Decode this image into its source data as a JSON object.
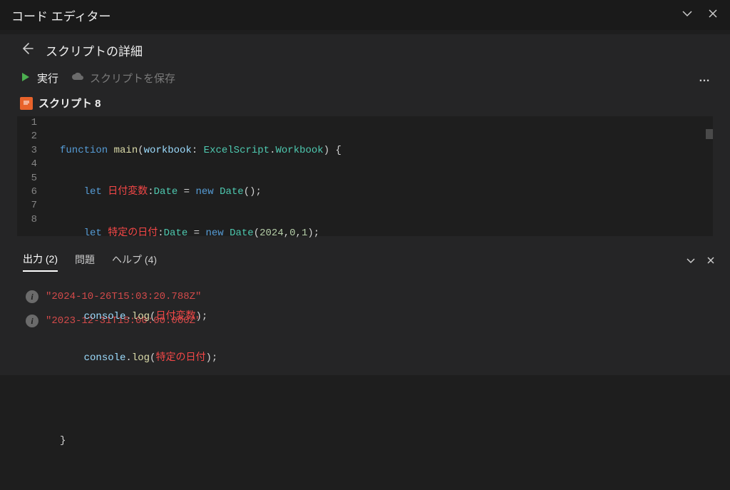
{
  "titlebar": {
    "title": "コード エディター"
  },
  "panel": {
    "header_title": "スクリプトの詳細",
    "run_label": "実行",
    "save_label": "スクリプトを保存",
    "more_label": "…",
    "script_name": "スクリプト 8"
  },
  "editor": {
    "line_numbers": [
      "1",
      "2",
      "3",
      "4",
      "5",
      "6",
      "7",
      "8"
    ],
    "code": {
      "l1": {
        "kw1": "function",
        "fn": "main",
        "p1": "(",
        "param": "workbook",
        "colon": ":",
        "ns": "ExcelScript",
        "dot": ".",
        "cls": "Workbook",
        "p2": ")",
        "sp": " ",
        "brace": "{"
      },
      "l2": {
        "kw": "let",
        "var": "日付変数",
        "colon": ":",
        "type": "Date",
        "eq": " = ",
        "new": "new",
        "sp": " ",
        "ctor": "Date",
        "args": "();"
      },
      "l3": {
        "kw": "let",
        "var": "特定の日付",
        "colon": ":",
        "type": "Date",
        "eq": " = ",
        "new": "new",
        "sp": " ",
        "ctor": "Date",
        "po": "(",
        "n1": "2024",
        "c1": ",",
        "n2": "0",
        "c2": ",",
        "n3": "1",
        "pc": ");"
      },
      "l5": {
        "obj": "console",
        "dot": ".",
        "fn": "log",
        "po": "(",
        "arg": "日付変数",
        "pc": ");"
      },
      "l6": {
        "obj": "console",
        "dot": ".",
        "fn": "log",
        "po": "(",
        "arg": "特定の日付",
        "pc": ");"
      },
      "l8": {
        "brace": "}"
      }
    }
  },
  "bottom": {
    "tab_output": "出力",
    "output_count": "(2)",
    "tab_problems": "問題",
    "tab_help": "ヘルプ",
    "help_count": "(4)"
  },
  "output": [
    {
      "text": "\"2024-10-26T15:03:20.788Z\""
    },
    {
      "text": "\"2023-12-31T15:00:00.000Z\""
    }
  ]
}
